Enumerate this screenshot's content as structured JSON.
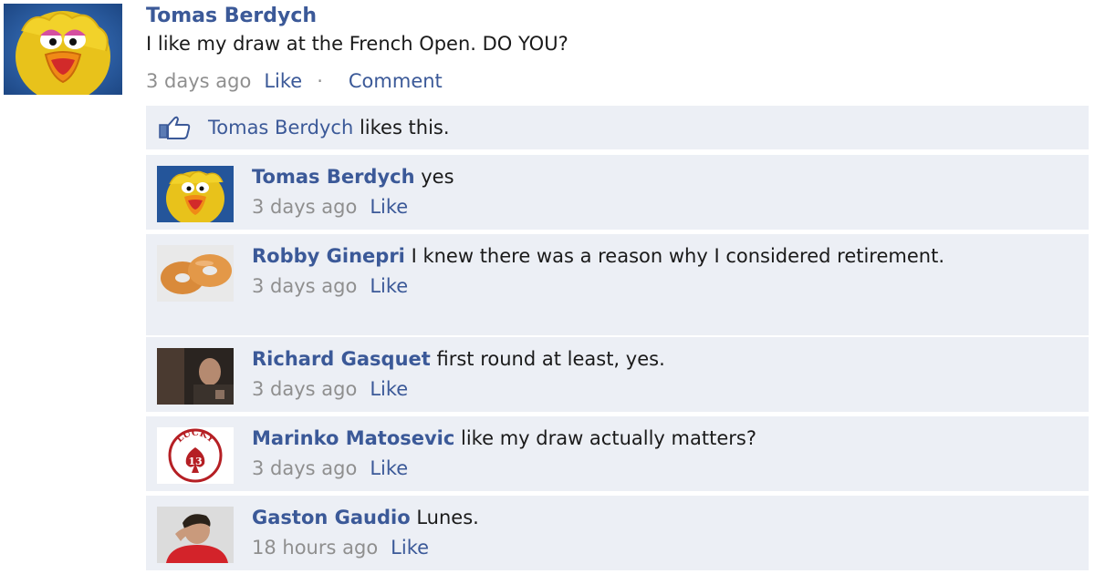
{
  "post": {
    "author": "Tomas Berdych",
    "text": "I like my draw at the French Open. DO YOU?",
    "time": "3 days ago",
    "like_label": "Like",
    "separator": "·",
    "comment_label": "Comment"
  },
  "likes": {
    "name": "Tomas Berdych",
    "suffix": " likes this."
  },
  "comments": [
    {
      "author": "Tomas Berdych",
      "text": "yes",
      "time": "3 days ago",
      "like_label": "Like",
      "avatar": "big-bird"
    },
    {
      "author": "Robby Ginepri",
      "text": "I knew there was a reason why I considered retirement.",
      "time": "3 days ago",
      "like_label": "Like",
      "avatar": "bagels"
    },
    {
      "author": "Richard Gasquet",
      "text": "first round at least, yes.",
      "time": "3 days ago",
      "like_label": "Like",
      "avatar": "dark-photo"
    },
    {
      "author": "Marinko Matosevic",
      "text": "like my draw actually matters?",
      "time": "3 days ago",
      "like_label": "Like",
      "avatar": "lucky-13"
    },
    {
      "author": "Gaston Gaudio",
      "text": "Lunes.",
      "time": "18 hours ago",
      "like_label": "Like",
      "avatar": "man-in-red"
    }
  ],
  "avatar_logo": {
    "top_text": "LUCKY",
    "number": "13"
  },
  "colors": {
    "link": "#3b5998",
    "panel": "#eceff5",
    "meta": "#8f8f8f"
  }
}
